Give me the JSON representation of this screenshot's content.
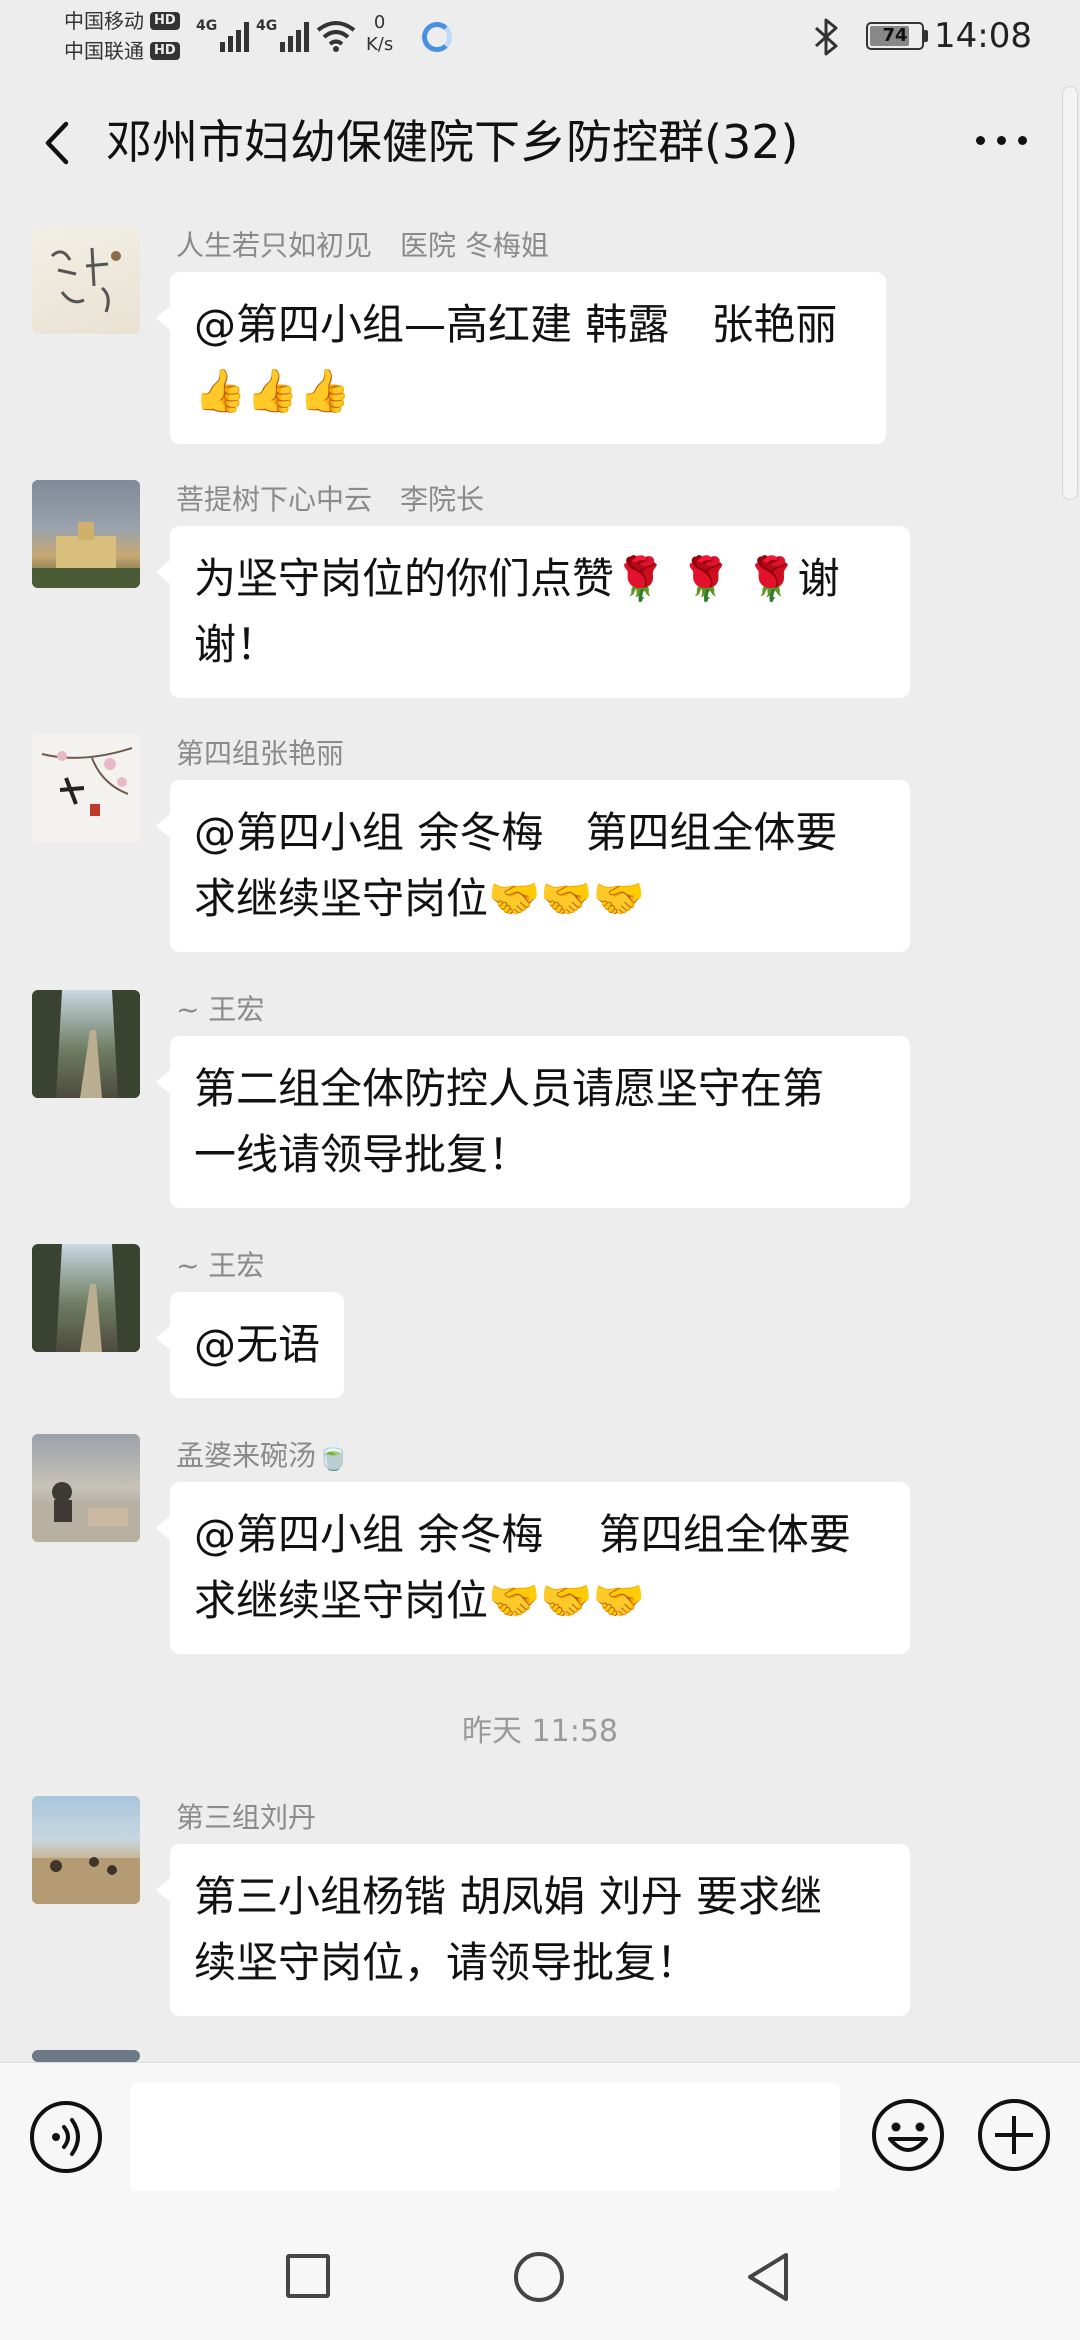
{
  "status": {
    "carrier1": "中国移动",
    "carrier2": "中国联通",
    "hd_label": "HD",
    "net_type": "4G",
    "speed_value": "0",
    "speed_unit": "K/s",
    "battery": "74",
    "time": "14:08"
  },
  "header": {
    "title": "邓州市妇幼保健院下乡防控群(32)"
  },
  "messages": [
    {
      "sender": "人生若只如初见　医院 冬梅姐",
      "line1": "@第四小组—高红建 韩露　张艳丽",
      "line2": "👍👍👍"
    },
    {
      "sender": "菩提树下心中云　李院长",
      "line1": "为坚守岗位的你们点赞🌹 🌹 🌹谢",
      "line2": "谢！"
    },
    {
      "sender": "第四组张艳丽",
      "line1": "@第四小组 余冬梅　第四组全体要",
      "line2": "求继续坚守岗位🤝🤝🤝"
    },
    {
      "sender": "~ 王宏",
      "line1": "第二组全体防控人员请愿坚守在第",
      "line2": "一线请领导批复！"
    },
    {
      "sender": "~ 王宏",
      "line1": "@无语",
      "line2": ""
    },
    {
      "sender": "孟婆来碗汤🍵",
      "line1": "@第四小组 余冬梅　 第四组全体要",
      "line2": "求继续坚守岗位🤝🤝🤝"
    },
    {
      "sender": "第三组刘丹",
      "line1": "第三小组杨锴 胡凤娟 刘丹 要求继",
      "line2": "续坚守岗位，请领导批复！"
    }
  ],
  "time_divider": "昨天 11:58",
  "colors": {
    "background": "#ededed",
    "bubble": "#ffffff",
    "sender_text": "#8a8a8a"
  }
}
